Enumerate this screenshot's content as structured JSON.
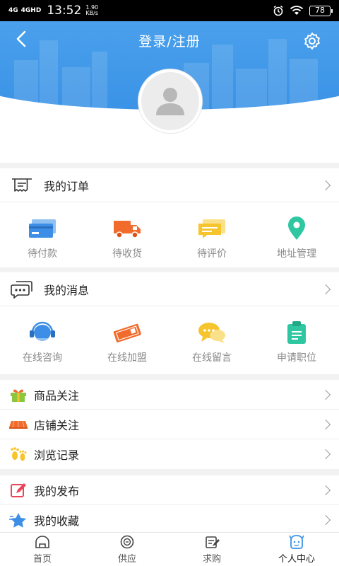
{
  "status_bar": {
    "signal_1": "4G",
    "signal_2": "4GHD",
    "time": "13:52",
    "speed_value": "1.90",
    "speed_unit": "KB/s",
    "battery": "78"
  },
  "header": {
    "title": "登录/注册",
    "back_icon": "chevron-left-icon",
    "settings_icon": "gear-icon",
    "avatar_icon": "user-placeholder-icon"
  },
  "orders": {
    "title": "我的订单",
    "items": [
      {
        "label": "待付款",
        "icon": "credit-card-icon",
        "color": "#3d8ee6"
      },
      {
        "label": "待收货",
        "icon": "truck-icon",
        "color": "#f06b2c"
      },
      {
        "label": "待评价",
        "icon": "comment-icon",
        "color": "#f6c42c"
      },
      {
        "label": "地址管理",
        "icon": "location-pin-icon",
        "color": "#2fc7a2"
      }
    ]
  },
  "messages": {
    "title": "我的消息",
    "items": [
      {
        "label": "在线咨询",
        "icon": "headset-icon",
        "color": "#3d8ee6"
      },
      {
        "label": "在线加盟",
        "icon": "ticket-icon",
        "color": "#f06b2c"
      },
      {
        "label": "在线留言",
        "icon": "chat-bubbles-icon",
        "color": "#f6c42c"
      },
      {
        "label": "申请职位",
        "icon": "clipboard-icon",
        "color": "#2fc7a2"
      }
    ]
  },
  "follows": [
    {
      "label": "商品关注",
      "icon": "gift-icon"
    },
    {
      "label": "店铺关注",
      "icon": "shop-awning-icon"
    },
    {
      "label": "浏览记录",
      "icon": "footprint-icon"
    }
  ],
  "mine": [
    {
      "label": "我的发布",
      "icon": "pencil-icon"
    },
    {
      "label": "我的收藏",
      "icon": "star-icon"
    }
  ],
  "nav": [
    {
      "label": "首页",
      "icon": "home-icon"
    },
    {
      "label": "供应",
      "icon": "supply-icon"
    },
    {
      "label": "求购",
      "icon": "purchase-icon"
    },
    {
      "label": "个人中心",
      "icon": "profile-icon"
    }
  ],
  "colors": {
    "header_blue": "#3b93e6",
    "accent_orange": "#f06b2c",
    "accent_yellow": "#f6c42c",
    "accent_green": "#2fc7a2",
    "nav_active": "#3b93e6"
  }
}
